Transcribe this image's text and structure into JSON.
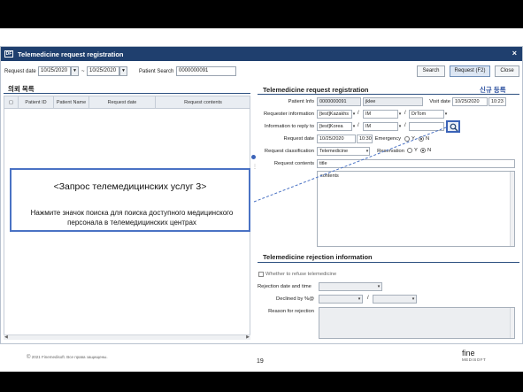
{
  "window": {
    "logo": "DF",
    "title": "Telemedicine request registration",
    "close_icon": "×"
  },
  "toolbar": {
    "request_date_label": "Request date",
    "date_from": "10/25/2020",
    "date_sep": "~",
    "date_to": "10/25/2020",
    "patient_search_label": "Patient Search",
    "patient_search_value": "0000000091",
    "search_label": "Search",
    "request_label": "Request (F2)",
    "close_label": "Close"
  },
  "left": {
    "title": "의뢰 목록",
    "columns": [
      "Patient ID",
      "Patient Name",
      "Request date",
      "Request contents"
    ]
  },
  "registration": {
    "title": "Telemedicine request registration",
    "new_label": "신규 등록",
    "patient_info_label": "Patient Info",
    "patient_id": "0000000091",
    "patient_name": "jklee",
    "visit_date_label": "Visit date",
    "visit_date": "10/25/2020",
    "visit_time": "10:23",
    "requester_label": "Requester information",
    "requester_country": "[test]Kazakhs",
    "requester_dept": "IM",
    "requester_doctor": "DrTom",
    "reply_label": "Information to reply to",
    "reply_country": "[test]Korea",
    "reply_dept": "IM",
    "reply_doctor": "",
    "request_date_label": "Request date",
    "request_date": "10/25/2020",
    "request_time": "10:30",
    "emergency_label": "Emergency",
    "radio_y": "Y",
    "radio_n": "N",
    "classification_label": "Request classification",
    "classification": "Telemedicine",
    "reservation_label": "Reservation",
    "contents_label": "Request contents",
    "contents_title": "title",
    "contents_body": "contents"
  },
  "rejection": {
    "title": "Telemedicine rejection information",
    "refuse_label": "Whether to refuse telemedicine",
    "date_label": "Rejection date and time",
    "declined_label": "Declined by %@",
    "reason_label": "Reason for rejection"
  },
  "callout": {
    "title": "<Запрос телемедицинских услуг 3>",
    "body": "Нажмите значок поиска для поиска доступного медицинского персонала в телемедицинских центрах"
  },
  "footer": {
    "copyright_symbol": "©",
    "copyright_text": "2021 Finemedisoft. Все права защищены.",
    "page_number": "19",
    "brand_main": "fine",
    "brand_sub": "MEDISOFT"
  },
  "colors": {
    "title_bar": "#1f3f6e",
    "accent": "#3b63b8"
  }
}
